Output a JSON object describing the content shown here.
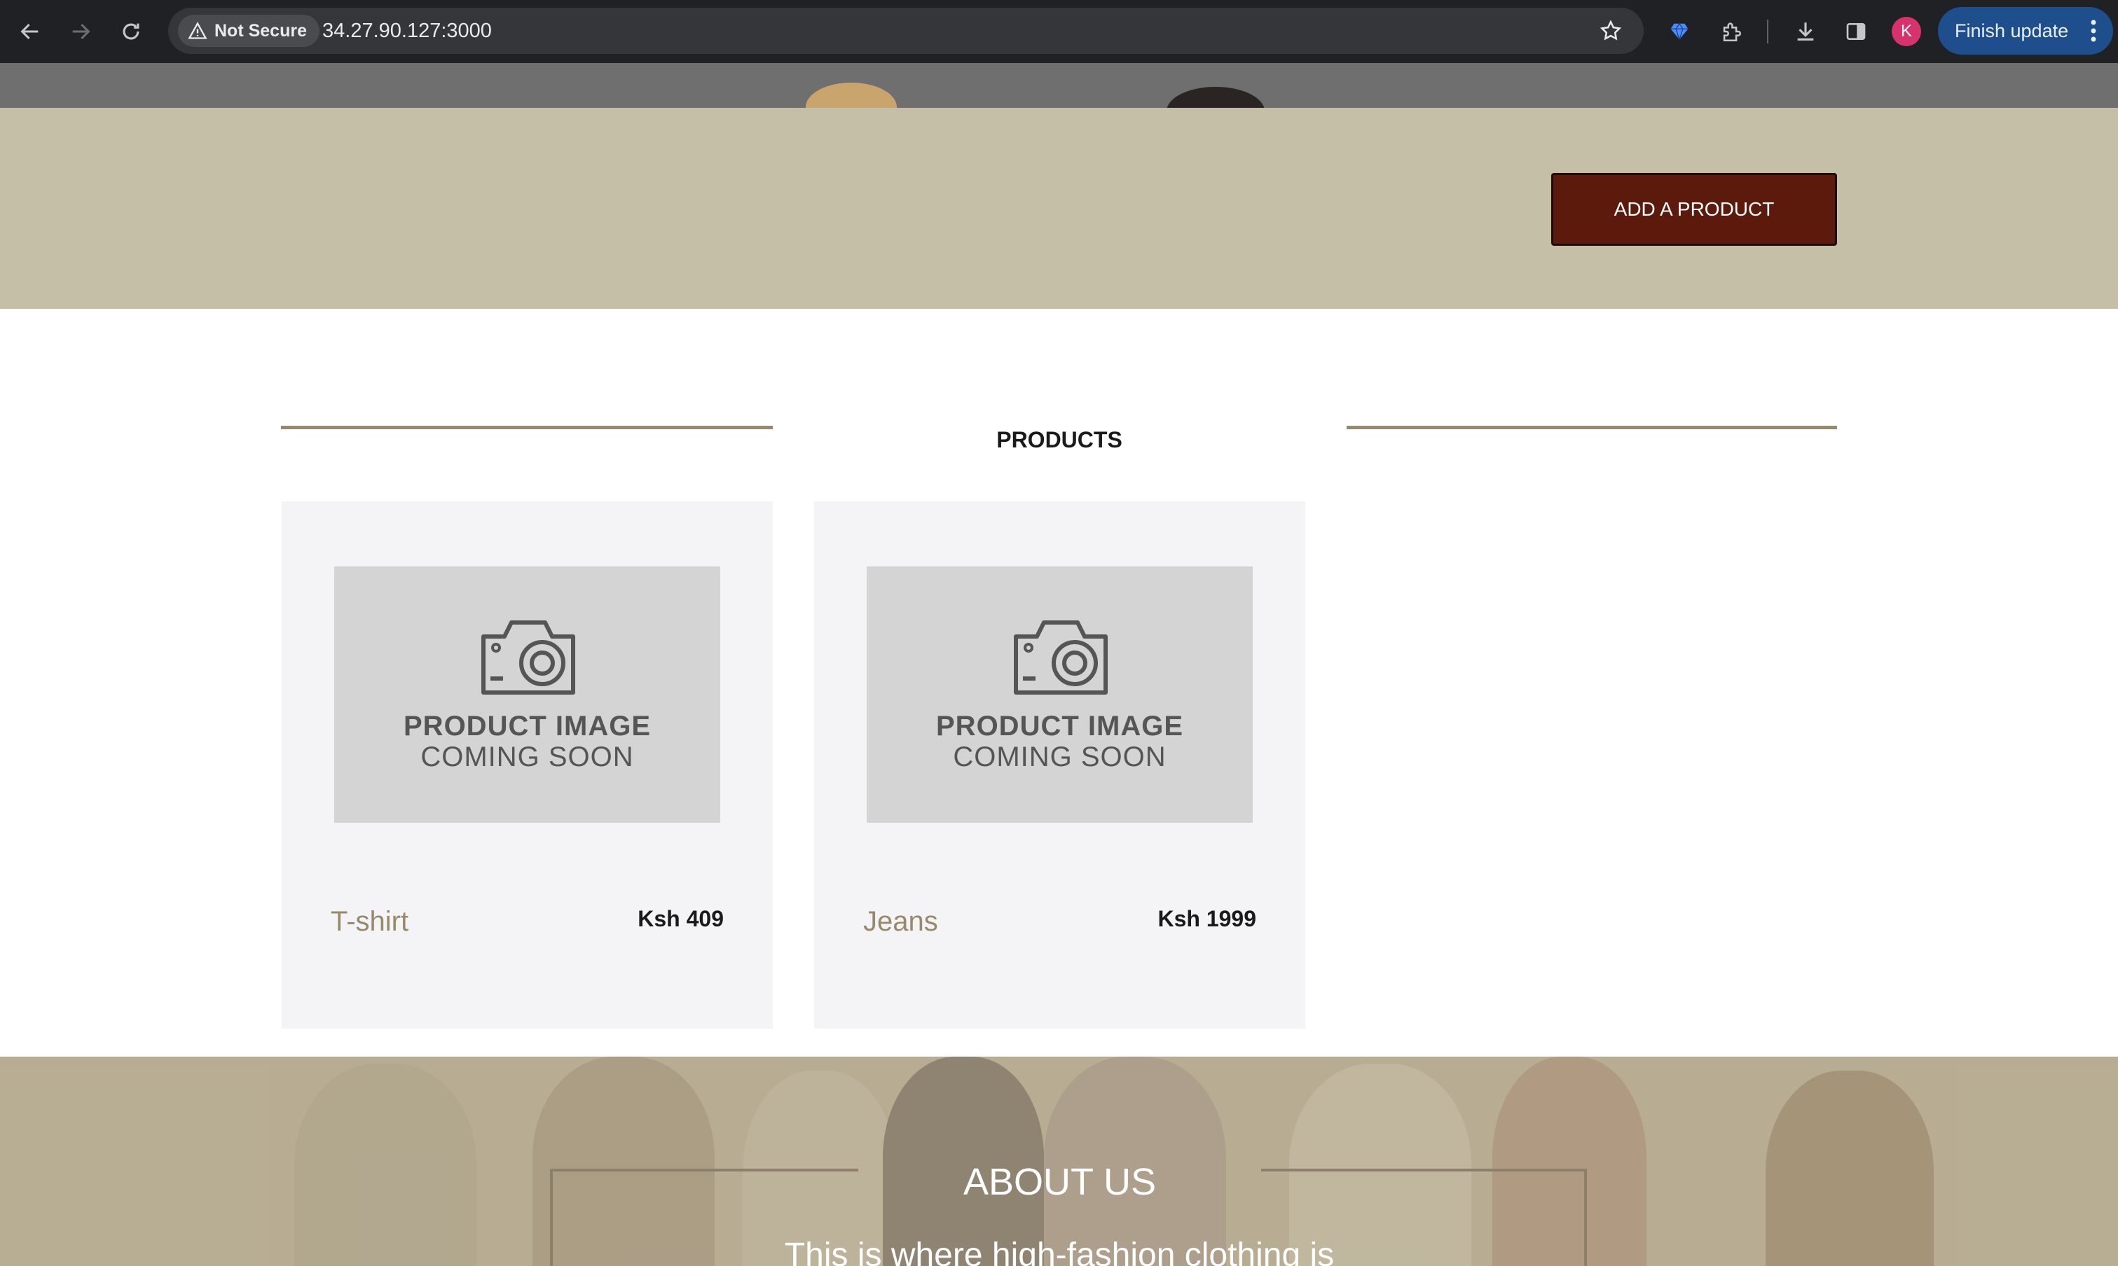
{
  "browser": {
    "security_label": "Not Secure",
    "url": "34.27.90.127:3000",
    "profile_initial": "K",
    "update_label": "Finish update"
  },
  "banner": {
    "add_product_label": "ADD A PRODUCT"
  },
  "products": {
    "heading": "PRODUCTS",
    "placeholder_line1": "PRODUCT IMAGE",
    "placeholder_line2": "COMING SOON",
    "items": [
      {
        "name": "T-shirt",
        "price": "Ksh 409"
      },
      {
        "name": "Jeans",
        "price": "Ksh 1999"
      }
    ]
  },
  "about": {
    "heading": "ABOUT US",
    "text": "This is where high-fashion clothing is"
  },
  "colors": {
    "banner_bg": "#c5bfa7",
    "accent_brown": "#978a6c",
    "add_button_bg": "#5c1a0d",
    "card_bg": "#f4f4f6"
  }
}
